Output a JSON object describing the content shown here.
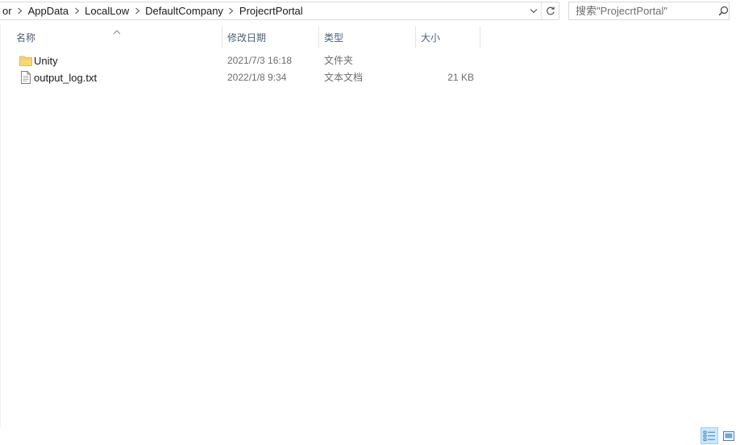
{
  "address_bar": {
    "crumbs": [
      "or",
      "AppData",
      "LocalLow",
      "DefaultCompany",
      "ProjecrtPortal"
    ]
  },
  "search": {
    "placeholder": "搜索\"ProjecrtPortal\""
  },
  "columns": {
    "name": "名称",
    "date_modified": "修改日期",
    "type": "类型",
    "size": "大小"
  },
  "files": [
    {
      "name": "Unity",
      "date": "2021/7/3 16:18",
      "type": "文件夹",
      "size": "",
      "icon": "folder-icon"
    },
    {
      "name": "output_log.txt",
      "date": "2022/1/8 9:34",
      "type": "文本文档",
      "size": "21 KB",
      "icon": "text-file-icon"
    }
  ],
  "colors": {
    "header_text": "#4c607a",
    "folder_yellow": "#f8d775",
    "active_view_bg": "#cce8ff"
  }
}
